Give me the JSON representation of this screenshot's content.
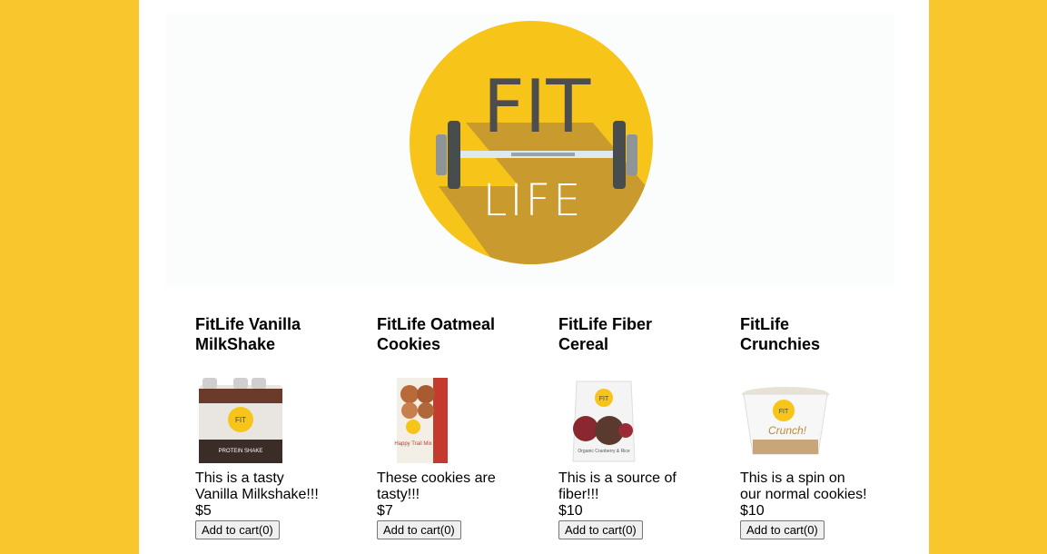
{
  "logo": {
    "line1": "FIT",
    "line2": "LIFE"
  },
  "colors": {
    "brand_yellow": "#F9C62B",
    "logo_circle": "#F7C519",
    "logo_shadow": "#C99A2E",
    "logo_text": "#4d4d4d"
  },
  "products": [
    {
      "name": "FitLife Vanilla MilkShake",
      "description": "This is a tasty Vanilla Milkshake!!!",
      "price": "$5",
      "button": "Add to cart(0)",
      "image_text": "PROTEIN SHAKE"
    },
    {
      "name": "FitLife Oatmeal Cookies",
      "description": "These cookies are tasty!!!",
      "price": "$7",
      "button": "Add to cart(0)",
      "image_text": "Happy Trail Mix"
    },
    {
      "name": "FitLife Fiber Cereal",
      "description": "This is a source of fiber!!!",
      "price": "$10",
      "button": "Add to cart(0)",
      "image_text": "Organic Cranberry & Rice"
    },
    {
      "name": "FitLife Crunchies",
      "description": "This is a spin on our normal cookies!",
      "price": "$10",
      "button": "Add to cart(0)",
      "image_text": "Crunch!"
    }
  ]
}
